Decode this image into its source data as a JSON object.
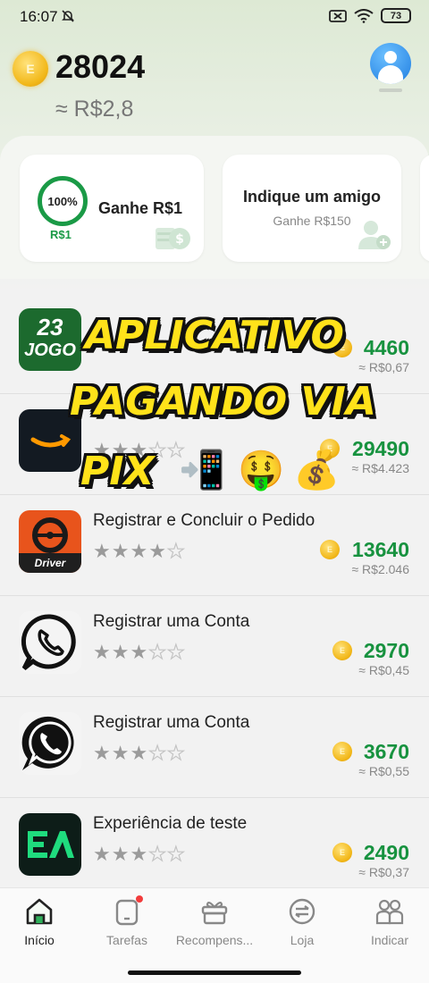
{
  "status_bar": {
    "time": "16:07",
    "battery": "73"
  },
  "header": {
    "coin_symbol": "E",
    "balance": "28024",
    "balance_brl": "≈ R$2,8"
  },
  "promo_cards": {
    "progress": {
      "percent_label": "100%",
      "percent_value": 100,
      "reward_label": "R$1",
      "title": "Ganhe R$1"
    },
    "invite": {
      "title": "Indique um amigo",
      "subtitle": "Ganhe R$150"
    }
  },
  "tasks": [
    {
      "app": "23 JOGO",
      "title": "",
      "rating": 3,
      "points": "4460",
      "brl": "≈ R$0,67"
    },
    {
      "app": "Amazon",
      "title": "",
      "rating": 3,
      "points": "29490",
      "brl": "≈ R$4.423"
    },
    {
      "app": "Driver",
      "title": "Registrar e Concluir o Pedido",
      "rating": 3.5,
      "points": "13640",
      "brl": "≈ R$2.046"
    },
    {
      "app": "WhatsApp",
      "title": "Registrar uma Conta",
      "rating": 3,
      "points": "2970",
      "brl": "≈ R$0,45"
    },
    {
      "app": "WhatsApp Business",
      "title": "Registrar uma Conta",
      "rating": 3,
      "points": "3670",
      "brl": "≈ R$0,55"
    },
    {
      "app": "EA",
      "title": "Experiência de teste",
      "rating": 3,
      "points": "2490",
      "brl": "≈ R$0,37"
    }
  ],
  "app_icon_texts": {
    "jogo_top": "23",
    "jogo_bottom": "JOGO",
    "driver": "Driver"
  },
  "overlay": {
    "line1": "APLICATIVO",
    "line2": "PAGANDO VIA",
    "line3": "PIX",
    "emojis": [
      "📲",
      "🤑",
      "💰"
    ]
  },
  "bottom_nav": [
    {
      "label": "Início",
      "icon": "home-icon",
      "active": true
    },
    {
      "label": "Tarefas",
      "icon": "tasks-icon",
      "badge": true
    },
    {
      "label": "Recompens...",
      "icon": "gift-icon"
    },
    {
      "label": "Loja",
      "icon": "store-icon"
    },
    {
      "label": "Indicar",
      "icon": "invite-icon"
    }
  ],
  "colors": {
    "accent_green": "#17923f",
    "coin_gold": "#f2b81a",
    "overlay_yellow": "#ffe21a"
  }
}
